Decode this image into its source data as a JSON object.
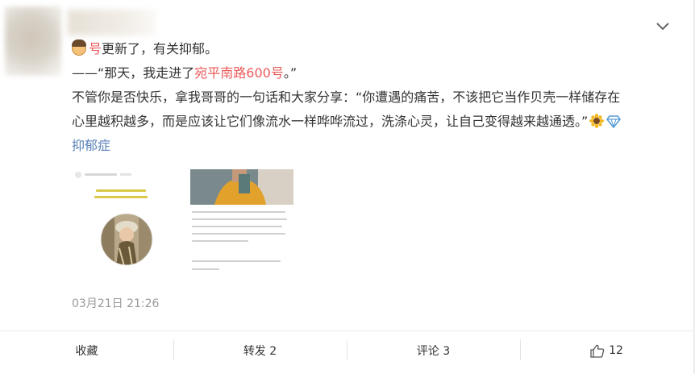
{
  "post": {
    "line1_prefix": "号",
    "line1_rest": "更新了，有关抑郁。",
    "line2_start": "——“那天，我走进了",
    "line2_highlight": "宛平南路600号",
    "line2_end": "。”",
    "line3": "不管你是否快乐，拿我哥哥的一句话和大家分享：“你遭遇的痛苦，不该把它当作贝壳一样储存在",
    "line4": "心里越积越多，而是应该让它们像流水一样哗哗流过，洗涤心灵，让自己变得越来越通透。”",
    "topic_link": "抑郁症",
    "timestamp": "03月21日 21:26"
  },
  "actions": {
    "favorite": "收藏",
    "repost": "转发 2",
    "comment": "评论 3",
    "like_count": "12"
  },
  "icons": [
    "person-emoji-icon",
    "sunflower-emoji-icon",
    "diamond-icon",
    "chevron-down-icon",
    "thumbs-up-icon"
  ],
  "colors": {
    "highlight": "#eb5a5a",
    "link": "#5a82b8",
    "timestamp": "#999999",
    "text": "#333333"
  }
}
